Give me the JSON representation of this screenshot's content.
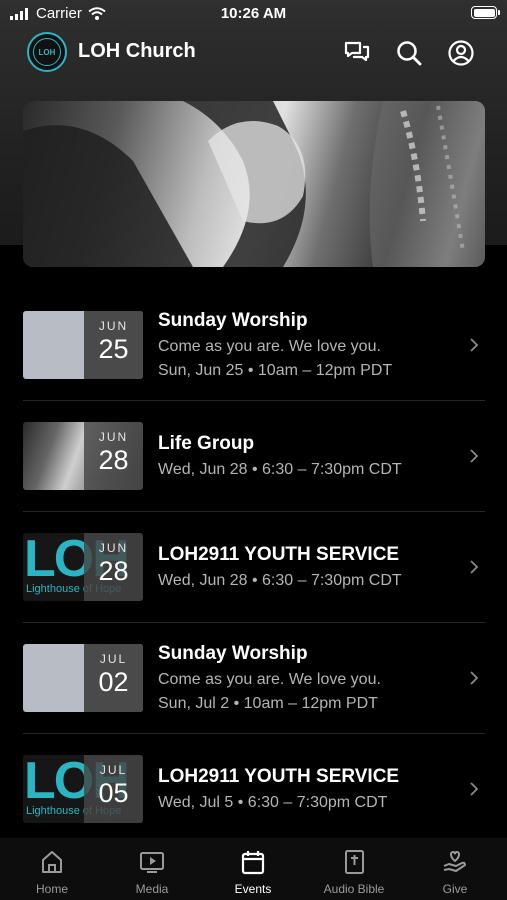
{
  "status_bar": {
    "carrier": "Carrier",
    "time": "10:26 AM"
  },
  "header": {
    "logo_text": "LOH",
    "title": "LOH Church",
    "icons": [
      "chat-icon",
      "search-icon",
      "profile-icon"
    ]
  },
  "hero": {
    "image": "hands-clasped-photo"
  },
  "events": [
    {
      "title": "Sunday Worship",
      "subtitle": "Come as you are. We love you.",
      "time": "Sun, Jun 25 • 10am – 12pm PDT",
      "month": "JUN",
      "day": "25",
      "thumb": "plain"
    },
    {
      "title": "Life Group",
      "subtitle": "",
      "time": "Wed, Jun 28 • 6:30 – 7:30pm CDT",
      "month": "JUN",
      "day": "28",
      "thumb": "photo"
    },
    {
      "title": "LOH2911 YOUTH SERVICE",
      "subtitle": "",
      "time": "Wed, Jun 28 • 6:30 – 7:30pm CDT",
      "month": "JUN",
      "day": "28",
      "thumb": "loh",
      "thumb_text": "LOH",
      "thumb_subtext": "Lighthouse of Hope"
    },
    {
      "title": "Sunday Worship",
      "subtitle": "Come as you are. We love you.",
      "time": "Sun, Jul 2 • 10am – 12pm PDT",
      "month": "JUL",
      "day": "02",
      "thumb": "plain"
    },
    {
      "title": "LOH2911 YOUTH SERVICE",
      "subtitle": "",
      "time": "Wed, Jul 5 • 6:30 – 7:30pm CDT",
      "month": "JUL",
      "day": "05",
      "thumb": "loh",
      "thumb_text": "LOH",
      "thumb_subtext": "Lighthouse of Hope"
    }
  ],
  "tabs": [
    {
      "label": "Home",
      "icon": "home-icon",
      "active": false
    },
    {
      "label": "Media",
      "icon": "media-icon",
      "active": false
    },
    {
      "label": "Events",
      "icon": "calendar-icon",
      "active": true
    },
    {
      "label": "Audio Bible",
      "icon": "bible-icon",
      "active": false
    },
    {
      "label": "Give",
      "icon": "give-icon",
      "active": false
    }
  ],
  "colors": {
    "background": "#000000",
    "accent": "#2bb5c3",
    "muted_text": "#b5b5b5"
  }
}
